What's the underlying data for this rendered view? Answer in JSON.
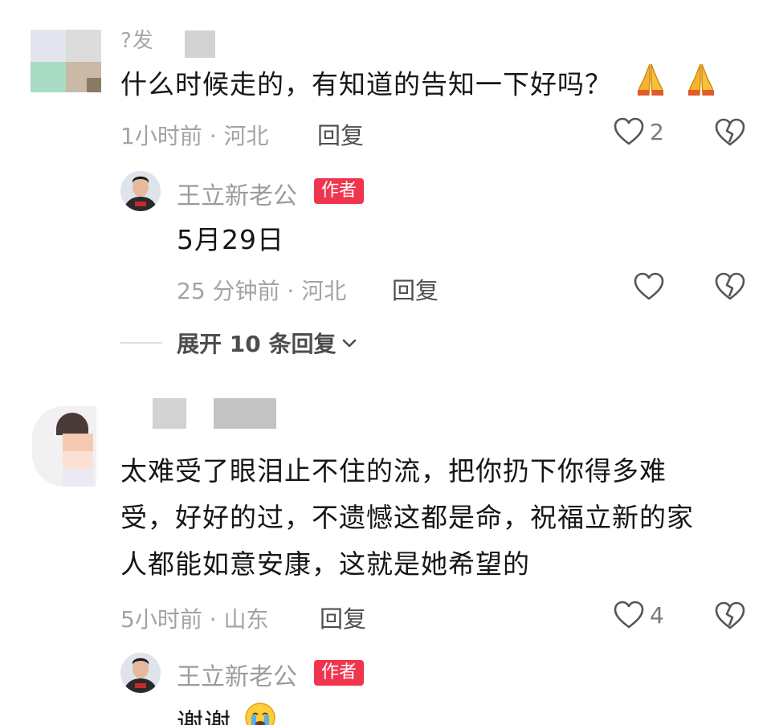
{
  "comment1": {
    "partial_name": "?发",
    "text": "什么时候走的，有知道的告知一下好吗？",
    "emoji_1": "folded-hands-emoji",
    "emoji_2": "folded-hands-emoji",
    "meta": "1小时前 · 河北",
    "reply_label": "回复",
    "likes": "2",
    "reply": {
      "name": "王立新老公",
      "badge": "作者",
      "text": "5月29日",
      "meta": "25 分钟前 · 河北",
      "reply_label": "回复",
      "likes": ""
    },
    "expand_label": "展开 10 条回复"
  },
  "comment2": {
    "lines": [
      "太难受了眼泪止不住的流，把你扔下你得多难",
      "受，好好的过，不遗憾这都是命，祝福立新的家",
      "人都能如意安康，这就是她希望的"
    ],
    "meta": "5小时前 · 山东",
    "reply_label": "回复",
    "likes": "4",
    "reply": {
      "name": "王立新老公",
      "badge": "作者",
      "text": "谢谢",
      "emoji": "loudly-crying-emoji"
    }
  },
  "colors": {
    "badge": "#f0364f",
    "meta_text": "#a3a3a3",
    "body_text": "#161616"
  }
}
